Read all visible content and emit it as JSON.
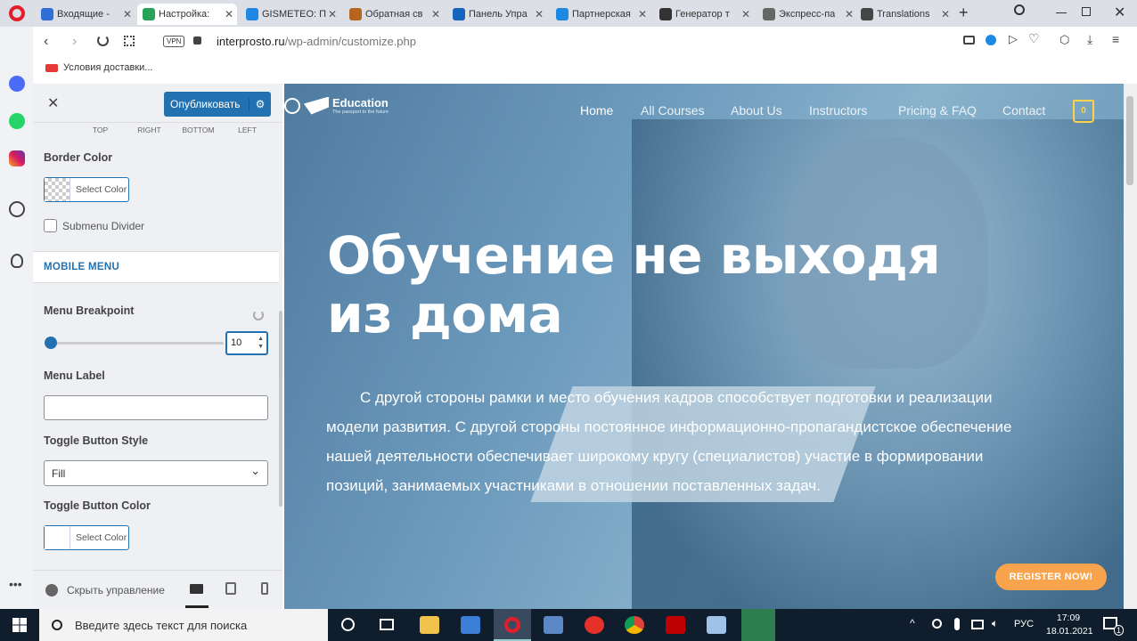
{
  "tabs": [
    {
      "title": "Входящие - ",
      "color": "#2f6fd6"
    },
    {
      "title": "Настройка: ",
      "color": "#2aa35a"
    },
    {
      "title": "GISMETEO: П",
      "color": "#1e88e5"
    },
    {
      "title": "Обратная св",
      "color": "#b5651d"
    },
    {
      "title": "Панель Упра",
      "color": "#1565c0"
    },
    {
      "title": "Партнерская",
      "color": "#1e88e5"
    },
    {
      "title": "Генератор т",
      "color": "#333333"
    },
    {
      "title": "Экспресс-па",
      "color": "#666666"
    },
    {
      "title": "Translations",
      "color": "#464646"
    }
  ],
  "address": {
    "vpn": "VPN",
    "domain": "interprosto.ru",
    "path": "/wp-admin/customize.php"
  },
  "bookmark": {
    "label": "Условия доставки..."
  },
  "customizer": {
    "publish": "Опубликовать",
    "sides": [
      "TOP",
      "RIGHT",
      "BOTTOM",
      "LEFT"
    ],
    "border_color": "Border Color",
    "select_color": "Select Color",
    "submenu_divider": "Submenu Divider",
    "mobile_menu": "MOBILE MENU",
    "menu_breakpoint": "Menu Breakpoint",
    "breakpoint_value": "10",
    "menu_label": "Menu Label",
    "toggle_style": "Toggle Button Style",
    "toggle_style_value": "Fill",
    "toggle_color": "Toggle Button Color",
    "hide_controls": "Скрыть управление"
  },
  "site": {
    "logo": "Education",
    "logo_sub": "The passport to the future",
    "nav": [
      "Home",
      "All Courses",
      "About Us",
      "Instructors",
      "Pricing & FAQ",
      "Contact"
    ],
    "cart_count": "0",
    "headline_1": "Обучение не выходя",
    "headline_2": "из дома",
    "paragraph": "С другой стороны рамки и место обучения кадров способствует подготовки и реализации модели развития. С другой стороны постоянное информационно-пропагандистское обеспечение нашей деятельности обеспечивает широкому кругу (специалистов) участие в формировании позиций, занимаемых участниками в отношении поставленных задач.",
    "register": "REGISTER NOW!"
  },
  "taskbar": {
    "search": "Введите здесь текст для поиска",
    "lang": "РУС",
    "time": "17:09",
    "date": "18.01.2021",
    "notif": "1"
  }
}
